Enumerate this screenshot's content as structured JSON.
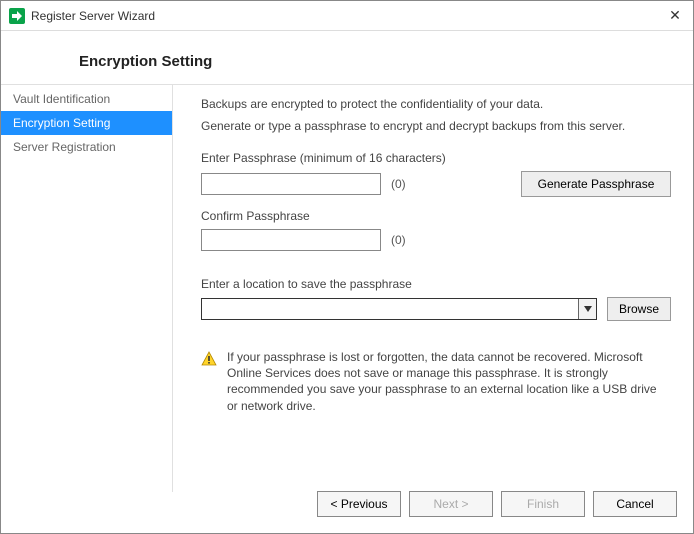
{
  "window": {
    "title": "Register Server Wizard"
  },
  "heading": "Encryption Setting",
  "sidebar": {
    "steps": [
      {
        "label": "Vault Identification",
        "active": false
      },
      {
        "label": "Encryption Setting",
        "active": true
      },
      {
        "label": "Server Registration",
        "active": false
      }
    ]
  },
  "main": {
    "intro1": "Backups are encrypted to protect the confidentiality of your data.",
    "intro2": "Generate or type a passphrase to encrypt and decrypt backups from this server.",
    "enter_label": "Enter Passphrase (minimum of 16 characters)",
    "enter_value": "",
    "enter_count": "(0)",
    "generate_label": "Generate Passphrase",
    "confirm_label": "Confirm Passphrase",
    "confirm_value": "",
    "confirm_count": "(0)",
    "location_label": "Enter a location to save the passphrase",
    "location_value": "",
    "browse_label": "Browse",
    "warning_text": "If your passphrase is lost or forgotten, the data cannot be recovered. Microsoft Online Services does not save or manage this passphrase. It is strongly recommended you save your passphrase to an external location like a USB drive or network drive."
  },
  "footer": {
    "previous": "< Previous",
    "next": "Next >",
    "finish": "Finish",
    "cancel": "Cancel"
  }
}
